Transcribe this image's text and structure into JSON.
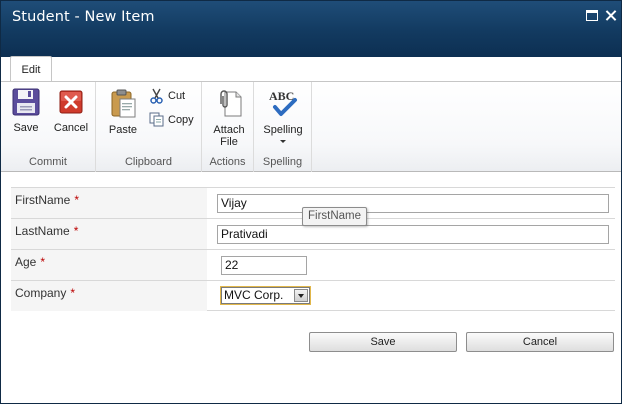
{
  "window": {
    "title": "Student - New Item"
  },
  "ribbon": {
    "tab": "Edit",
    "groups": {
      "commit": "Commit",
      "clipboard": "Clipboard",
      "actions": "Actions",
      "spelling": "Spelling"
    },
    "buttons": {
      "save": "Save",
      "cancel": "Cancel",
      "paste": "Paste",
      "cut": "Cut",
      "copy": "Copy",
      "attach_line1": "Attach",
      "attach_line2": "File",
      "spelling": "Spelling"
    },
    "icons": {
      "spelling_text": "ABC"
    }
  },
  "form": {
    "fields": [
      {
        "label": "FirstName",
        "required": "*",
        "value": "Vijay"
      },
      {
        "label": "LastName",
        "required": "*",
        "value": "Prativadi"
      },
      {
        "label": "Age",
        "required": "*",
        "value": "22"
      },
      {
        "label": "Company",
        "required": "*",
        "value": "MVC Corp."
      }
    ],
    "tooltip": "FirstName"
  },
  "footer": {
    "save": "Save",
    "cancel": "Cancel"
  },
  "colors": {
    "title_bar": "#123a60",
    "required": "#bb0000",
    "select_focus": "#e1b74a"
  }
}
